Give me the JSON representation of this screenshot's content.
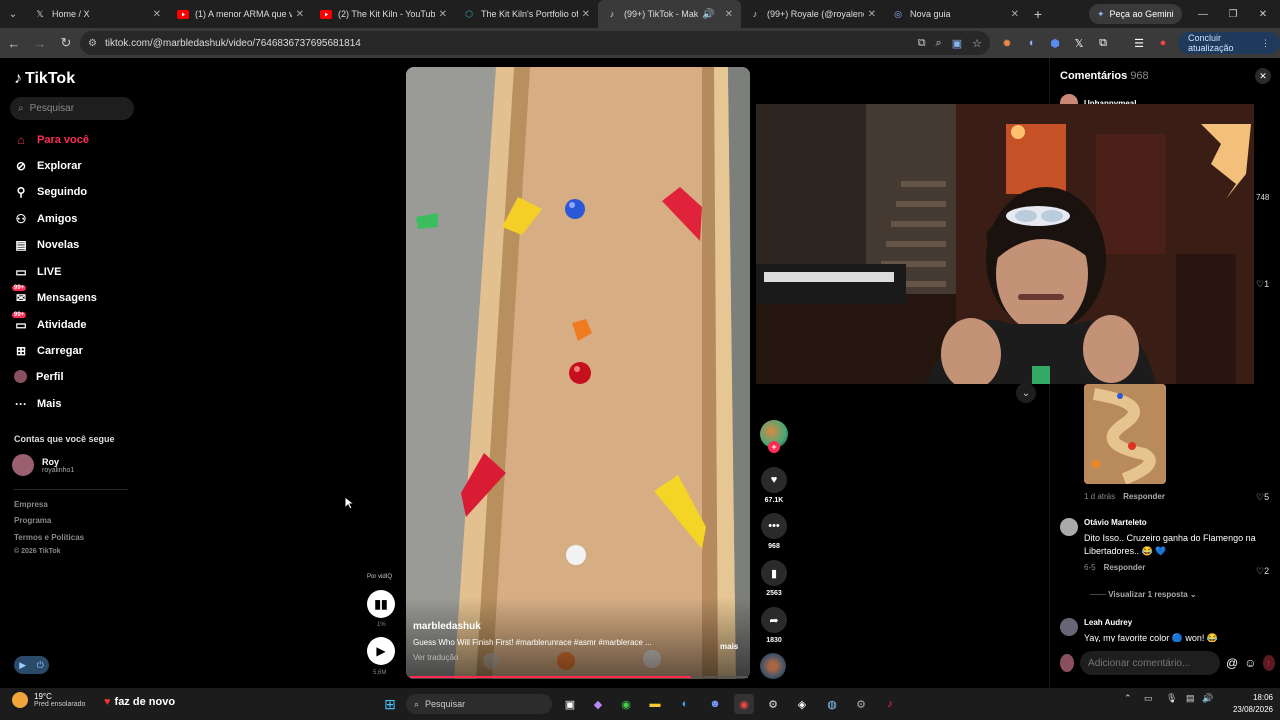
{
  "browser": {
    "tabs": [
      {
        "title": "Home / X",
        "icon": "x-logo-icon",
        "active": false
      },
      {
        "title": "(1) A menor ARMA que você",
        "icon": "youtube-icon",
        "active": false
      },
      {
        "title": "(2) The Kit Kiln - YouTube",
        "icon": "youtube-icon",
        "active": false
      },
      {
        "title": "The Kit Kiln's Portfolio of 3D",
        "icon": "printables-icon",
        "active": false
      },
      {
        "title": "(99+) TikTok - Make Yo",
        "icon": "tiktok-icon",
        "active": true
      },
      {
        "title": "(99+) Royale (@royalenene",
        "icon": "tiktok-icon",
        "active": false
      },
      {
        "title": "Nova guia",
        "icon": "chrome-icon",
        "active": false
      }
    ],
    "gemini_label": "Peça ao Gemini",
    "url": "tiktok.com/@marbledashuk/video/7646836737695681814",
    "update_label": "Concluir atualização"
  },
  "sidebar": {
    "logo": "TikTok",
    "search_placeholder": "Pesquisar",
    "items": [
      {
        "label": "Para você",
        "icon": "home-icon",
        "active": true
      },
      {
        "label": "Explorar",
        "icon": "compass-icon"
      },
      {
        "label": "Seguindo",
        "icon": "following-icon"
      },
      {
        "label": "Amigos",
        "icon": "friends-icon"
      },
      {
        "label": "Novelas",
        "icon": "novelas-icon"
      },
      {
        "label": "LIVE",
        "icon": "live-icon"
      },
      {
        "label": "Mensagens",
        "icon": "messages-icon",
        "badge": "99+"
      },
      {
        "label": "Atividade",
        "icon": "activity-icon",
        "badge": "99+"
      },
      {
        "label": "Carregar",
        "icon": "upload-icon"
      },
      {
        "label": "Perfil",
        "icon": "profile-icon"
      },
      {
        "label": "Mais",
        "icon": "more-icon"
      }
    ],
    "following_title": "Contas que você segue",
    "following": [
      {
        "name": "Roy",
        "handle": "royalinho1"
      }
    ],
    "footer": [
      "Empresa",
      "Programa",
      "Termos e Políticas"
    ],
    "copyright": "© 2026 TikTok"
  },
  "video": {
    "username": "marbledashuk",
    "description": "Guess Who Will Finish First! #marblerunrace #asmr #marblerace ...",
    "more_label": "mais",
    "translate_label": "Ver tradução",
    "progress": 0.83
  },
  "vidiq": {
    "label": "Por vidIQ",
    "percent": "1%",
    "plays": "5,6M"
  },
  "actions": {
    "likes": "67.1K",
    "comments": "968",
    "saves": "2563",
    "shares": "1830"
  },
  "comments_panel": {
    "title": "Comentários",
    "count": "968",
    "items": [
      {
        "author": "Unhappymeal",
        "text": "",
        "time": "",
        "reply": "",
        "likes": ""
      },
      {
        "author": "",
        "text": "",
        "time": "",
        "reply": "",
        "likes": "748"
      },
      {
        "author": "",
        "text": "",
        "time": "",
        "reply": "",
        "likes": "1"
      },
      {
        "author": "",
        "text": "",
        "time": "1 d atrás",
        "reply": "Responder",
        "likes": "5"
      },
      {
        "author": "Otávio Marteleto",
        "text": "Dito Isso.. Cruzeiro ganha do Flamengo na Libertadores.. 😂 💙",
        "time": "6-5",
        "reply": "Responder",
        "likes": "2"
      },
      {
        "author": "Leah Audrey",
        "text": "Yay, my favorite color 🔵 won! 😂",
        "time": "",
        "reply": "",
        "likes": ""
      }
    ],
    "view_replies": "Visualizar 1 resposta",
    "input_placeholder": "Adicionar comentário..."
  },
  "taskbar": {
    "temperature": "19°C",
    "weather_desc": "Pred ensolarado",
    "news_text": "faz de novo",
    "search_placeholder": "Pesquisar",
    "time": "18:06",
    "date": "23/08/2026"
  }
}
